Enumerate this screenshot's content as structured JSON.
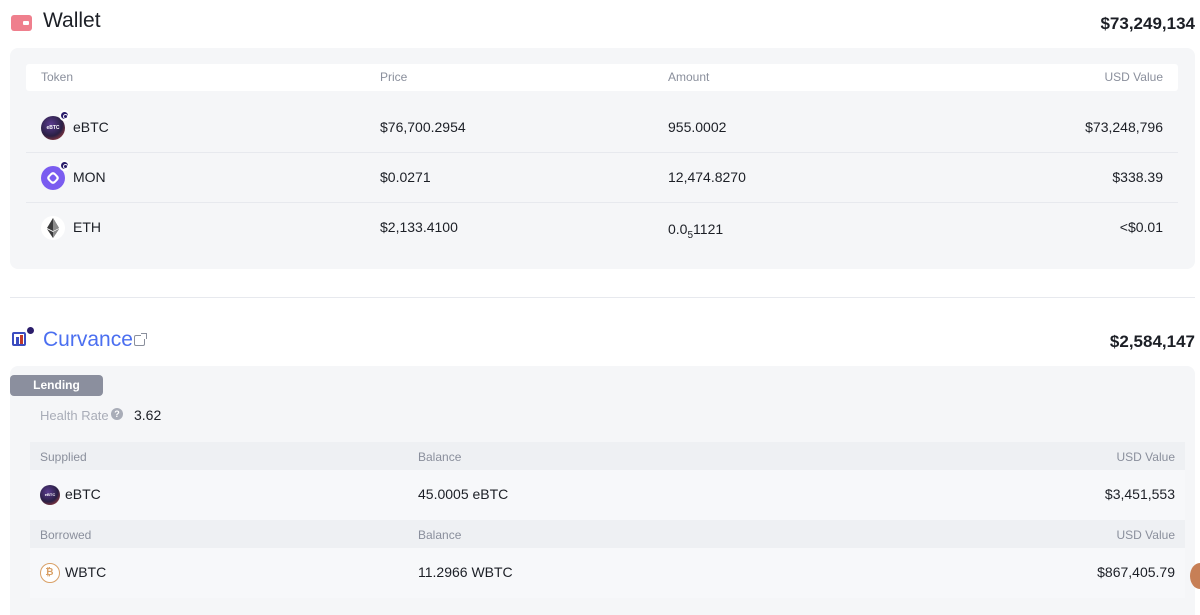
{
  "wallet": {
    "title": "Wallet",
    "total": "$73,249,134",
    "columns": {
      "token": "Token",
      "price": "Price",
      "amount": "Amount",
      "usd_value": "USD Value"
    },
    "rows": [
      {
        "icon": "ebtc-icon",
        "icon_text": "eBTC",
        "token": "eBTC",
        "price": "$76,700.2954",
        "amount": "955.0002",
        "usd_value": "$73,248,796"
      },
      {
        "icon": "mon-icon",
        "token": "MON",
        "price": "$0.0271",
        "amount": "12,474.8270",
        "usd_value": "$338.39"
      },
      {
        "icon": "eth-icon",
        "token": "ETH",
        "price": "$2,133.4100",
        "amount_prefix": "0.0",
        "amount_sub": "5",
        "amount_suffix": "1121",
        "usd_value": "<$0.01"
      }
    ]
  },
  "curvance": {
    "title": "Curvance",
    "total": "$2,584,147",
    "tab": "Lending",
    "health_label": "Health Rate",
    "health_help": "?",
    "health_value": "3.62",
    "supplied": {
      "columns": {
        "token": "Supplied",
        "balance": "Balance",
        "usd_value": "USD Value"
      },
      "row": {
        "icon_text": "eBTC",
        "token": "eBTC",
        "balance": "45.0005 eBTC",
        "usd_value": "$3,451,553"
      }
    },
    "borrowed": {
      "columns": {
        "token": "Borrowed",
        "balance": "Balance",
        "usd_value": "USD Value"
      },
      "row": {
        "icon_text": "₿",
        "token": "WBTC",
        "balance": "11.2966 WBTC",
        "usd_value": "$867,405.79"
      }
    }
  },
  "colors": {
    "accent": "#4b6ff0",
    "wallet_icon": "#ef7f8d",
    "tab_bg": "#8b8f9e"
  }
}
